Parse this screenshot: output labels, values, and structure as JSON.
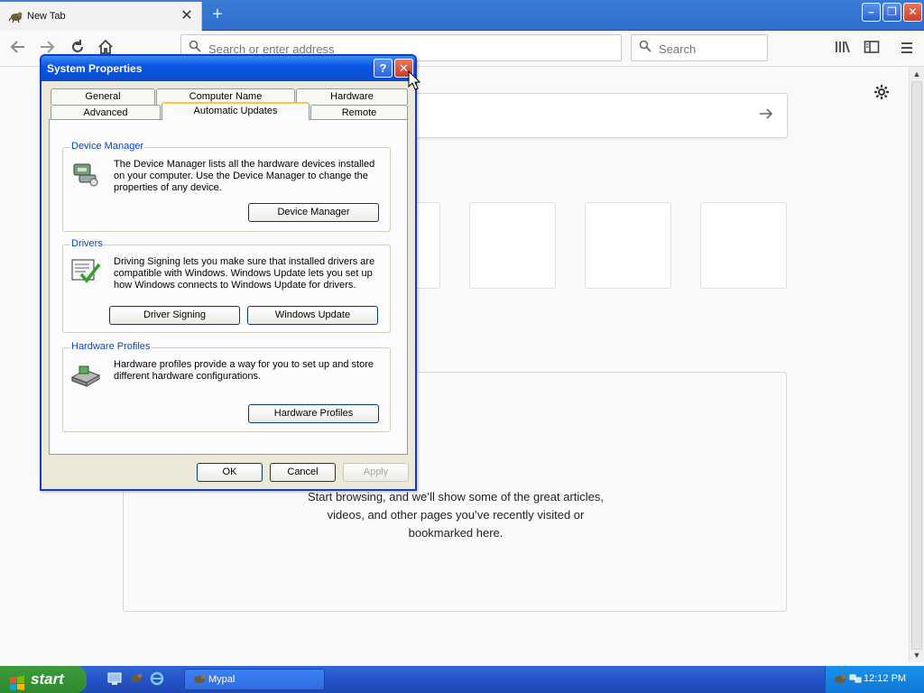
{
  "browser": {
    "tab_title": "New Tab",
    "tab_close": "✕",
    "new_tab": "+",
    "address_placeholder": "Search or enter address",
    "search_placeholder": "Search",
    "window": {
      "minimize": "–",
      "maximize": "❐",
      "close": "✕"
    }
  },
  "page": {
    "highlights_message_1": "Start browsing, and we’ll show some of the great articles,",
    "highlights_message_2": "videos, and other pages you’ve recently visited or",
    "highlights_message_3": "bookmarked here."
  },
  "dialog": {
    "title": "System Properties",
    "help": "?",
    "close": "✕",
    "tabs_row1": [
      "General",
      "Computer Name",
      "Hardware"
    ],
    "tabs_row2": [
      "Advanced",
      "Automatic Updates",
      "Remote"
    ],
    "active_tab": "Automatic Updates",
    "groups": {
      "device_manager": {
        "title": "Device Manager",
        "description": "The Device Manager lists all the hardware devices installed on your computer. Use the Device Manager to change the properties of any device.",
        "button": "Device Manager"
      },
      "drivers": {
        "title": "Drivers",
        "description": "Driving Signing lets you make sure that installed drivers are compatible with Windows. Windows Update lets you set up how Windows connects to Windows Update for drivers.",
        "button_signing": "Driver Signing",
        "button_update": "Windows Update"
      },
      "hardware_profiles": {
        "title": "Hardware Profiles",
        "description": "Hardware profiles provide a way for you to set up and store different hardware configurations.",
        "button": "Hardware Profiles"
      }
    },
    "buttons": {
      "ok": "OK",
      "cancel": "Cancel",
      "apply": "Apply"
    }
  },
  "taskbar": {
    "start": "start",
    "task_button": "Mypal",
    "clock": "12:12 PM"
  },
  "colors": {
    "titlebar": "#0a56e3",
    "accent_tab": "#ffc83c",
    "group_title": "#0046d5",
    "start_green": "#2f8a2f"
  }
}
